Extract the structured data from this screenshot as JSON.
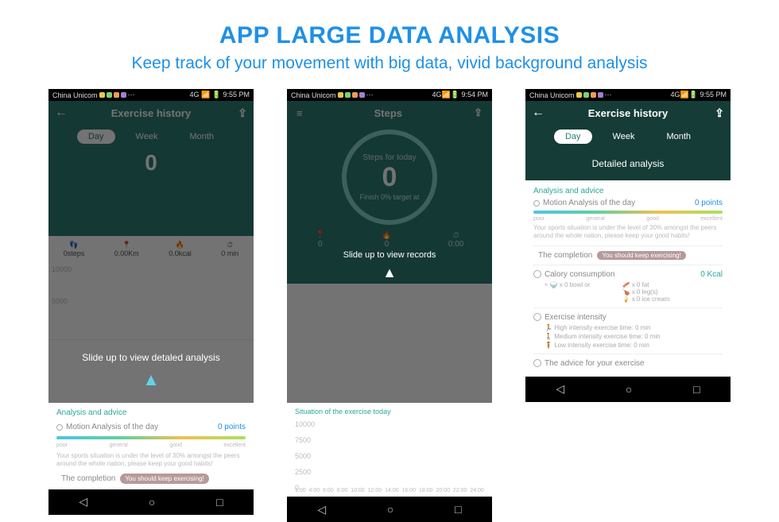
{
  "header": {
    "title": "APP LARGE DATA ANALYSIS",
    "subtitle": "Keep track of your movement with big data, vivid background analysis"
  },
  "status_bar": {
    "carrier": "China Unicom",
    "time_1": "9:55 PM",
    "time_2": "9:54 PM",
    "time_3": "9:55 PM",
    "signal": "4G"
  },
  "phone1": {
    "screen_title": "Exercise history",
    "tabs": {
      "day": "Day",
      "week": "Week",
      "month": "Month"
    },
    "main_value": "0",
    "stats": {
      "steps": {
        "label": "0steps"
      },
      "km": {
        "label": "0.00Km"
      },
      "kcal": {
        "label": "0.0kcal"
      },
      "min": {
        "label": "0 min"
      }
    },
    "yaxis": [
      "10000",
      "5000"
    ],
    "hint": "Slide up to view detaled analysis",
    "panel": {
      "title": "Analysis and advice",
      "motion_label": "Motion Analysis of the day",
      "motion_value": "0 points",
      "scale": [
        "poor",
        "general",
        "good",
        "excellent"
      ],
      "description": "Your sports situation is under the level of 30% amongst the peers around the whole nation, please keep your good habits!",
      "completion_label": "The completion",
      "completion_badge": "You should keep exercising!"
    }
  },
  "phone2": {
    "screen_title": "Steps",
    "ring": {
      "label": "Steps for today",
      "value": "0",
      "pct": "Finish 0% target at"
    },
    "stats": {
      "dist": "0",
      "cal": "0",
      "time": "0:00"
    },
    "hint": "Slide up to view records",
    "situation_label": "Situation of the exercise today",
    "yaxis": [
      "10000",
      "7500",
      "5000",
      "2500",
      "0"
    ],
    "xaxis": [
      "1:00",
      "4:00",
      "6:00",
      "8:00",
      "10:00",
      "12:00",
      "14:00",
      "16:00",
      "18:00",
      "20:00",
      "22:00",
      "24:00"
    ]
  },
  "phone3": {
    "screen_title": "Exercise history",
    "tabs": {
      "day": "Day",
      "week": "Week",
      "month": "Month"
    },
    "detailed_label": "Detailed analysis",
    "panel_title": "Analysis and advice",
    "motion_label": "Motion Analysis of the day",
    "motion_value": "0 points",
    "scale": [
      "poor",
      "general",
      "good",
      "excellent"
    ],
    "description": "Your sports situation is under the level of 30% amongst the peers around the whole nation, please keep your good habits!",
    "completion_label": "The completion",
    "completion_badge": "You should keep exercising!",
    "calorie_label": "Calory consumption",
    "calorie_value": "0 Kcal",
    "equiv": {
      "fat": "x 0 fat",
      "bowl": "x 0 bowl",
      "leg": "x 0 leg(s)",
      "icecream": "x 0 ice cream"
    },
    "eq_sym": "≈",
    "or_sym": "or",
    "intensity_label": "Exercise intensity",
    "intensity": {
      "high": "High intensity exercise time:  0 min",
      "medium": "Medium intensity exercise time:  0 min",
      "low": "Low intensity exercise time:  0 min"
    },
    "advice_label": "The advice for your exercise"
  }
}
